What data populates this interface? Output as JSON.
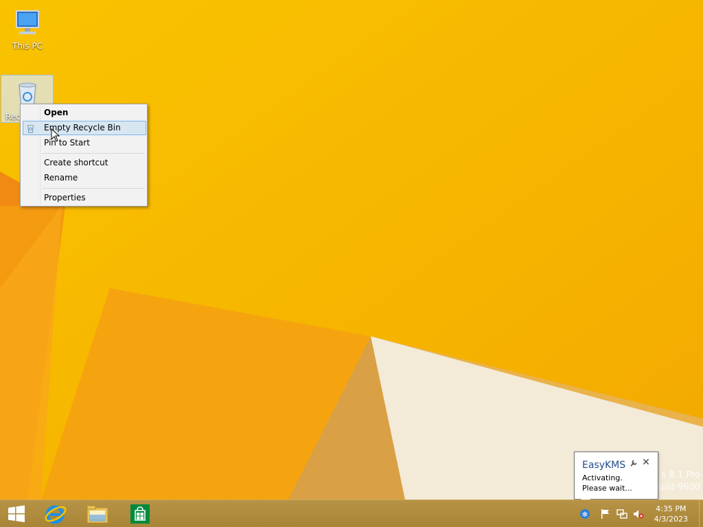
{
  "desktop": {
    "icons": [
      {
        "label": "This PC",
        "icon": "computer-icon"
      },
      {
        "label": "Rec",
        "icon": "recycle-bin-icon"
      }
    ],
    "watermark": {
      "line1": "s 8.1 Pro",
      "line2": "uild 9600"
    }
  },
  "context_menu": {
    "items": [
      {
        "label": "Open",
        "bold": true
      },
      {
        "label": "Empty Recycle Bin",
        "highlighted": true,
        "icon": "recycle-bin-small-icon"
      },
      {
        "label": "Pin to Start"
      },
      {
        "label": "Create shortcut"
      },
      {
        "label": "Rename"
      },
      {
        "label": "Properties"
      }
    ]
  },
  "notification": {
    "title": "EasyKMS",
    "line1": "Activating.",
    "line2": "Please wait...",
    "close_glyph": "✕"
  },
  "taskbar": {
    "pinned": [
      "start-windows-icon",
      "internet-explorer-icon",
      "file-explorer-icon",
      "windows-store-icon"
    ],
    "tray": [
      "easykms-icon",
      "action-center-flag-icon",
      "network-icon",
      "volume-muted-icon"
    ],
    "clock": {
      "time": "4:35 PM",
      "date": "4/3/2023"
    }
  },
  "colors": {
    "wallpaper_base": "#f5b800",
    "taskbar": "#a88536",
    "menu_highlight": "#d8e6f2",
    "notification_title": "#1e4e8c"
  }
}
